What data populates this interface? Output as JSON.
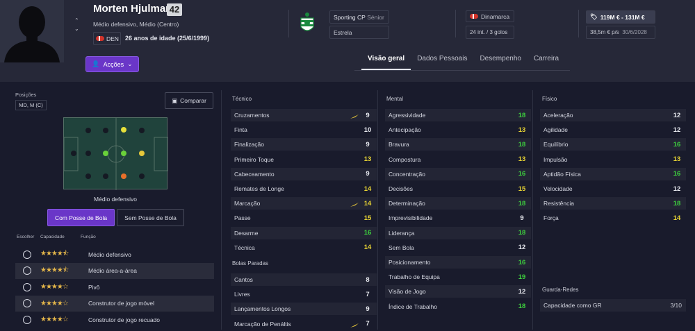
{
  "player": {
    "name": "Morten Hjulmand",
    "number": "42",
    "position": "Médio defensivo, Médio (Centro)",
    "nationality_code": "DEN",
    "age_line": "26 anos de idade (25/6/1999)"
  },
  "actions_label": "Acções",
  "club": {
    "name": "Sporting CP",
    "squad": "Sénior",
    "status": "Estrela"
  },
  "nation": {
    "name": "Dinamarca",
    "caps": "24 int. / 3 golos"
  },
  "value": {
    "range": "119M € - 131M €",
    "wage": "38,5m € p/s",
    "contract_end": "30/6/2028"
  },
  "tabs": [
    "Visão geral",
    "Dados Pessoais",
    "Desempenho",
    "Carreira"
  ],
  "left": {
    "positions_label": "Posições",
    "positions_value": "MD, M (C)",
    "compare_label": "Comparar",
    "pitch_caption": "Médio defensivo",
    "with_ball": "Com Posse de Bola",
    "without_ball": "Sem Posse de Bola",
    "col_choose": "Escolher",
    "col_ability": "Capacidade",
    "col_role": "Função"
  },
  "roles": [
    {
      "name": "Médio defensivo",
      "stars": 4.5
    },
    {
      "name": "Médio área-a-área",
      "stars": 4.5
    },
    {
      "name": "Pivô",
      "stars": 4
    },
    {
      "name": "Construtor de jogo móvel",
      "stars": 4
    },
    {
      "name": "Construtor de jogo recuado",
      "stars": 4
    }
  ],
  "technical": {
    "title": "Técnico",
    "attrs": [
      {
        "n": "Cruzamentos",
        "v": "9"
      },
      {
        "n": "Finta",
        "v": "10"
      },
      {
        "n": "Finalização",
        "v": "9"
      },
      {
        "n": "Primeiro Toque",
        "v": "13"
      },
      {
        "n": "Cabeceamento",
        "v": "9"
      },
      {
        "n": "Remates de Longe",
        "v": "14"
      },
      {
        "n": "Marcação",
        "v": "14"
      },
      {
        "n": "Passe",
        "v": "15"
      },
      {
        "n": "Desarme",
        "v": "16"
      },
      {
        "n": "Técnica",
        "v": "14"
      }
    ]
  },
  "set_pieces": {
    "title": "Bolas Paradas",
    "attrs": [
      {
        "n": "Cantos",
        "v": "8"
      },
      {
        "n": "Livres",
        "v": "7"
      },
      {
        "n": "Lançamentos Longos",
        "v": "9"
      },
      {
        "n": "Marcação de Penáltis",
        "v": "7"
      }
    ]
  },
  "mental": {
    "title": "Mental",
    "attrs": [
      {
        "n": "Agressividade",
        "v": "18"
      },
      {
        "n": "Antecipação",
        "v": "13"
      },
      {
        "n": "Bravura",
        "v": "18"
      },
      {
        "n": "Compostura",
        "v": "13"
      },
      {
        "n": "Concentração",
        "v": "16"
      },
      {
        "n": "Decisões",
        "v": "15"
      },
      {
        "n": "Determinação",
        "v": "18"
      },
      {
        "n": "Imprevisibilidade",
        "v": "9"
      },
      {
        "n": "Liderança",
        "v": "18"
      },
      {
        "n": "Sem Bola",
        "v": "12"
      },
      {
        "n": "Posicionamento",
        "v": "16"
      },
      {
        "n": "Trabalho de Equipa",
        "v": "19"
      },
      {
        "n": "Visão de Jogo",
        "v": "12"
      },
      {
        "n": "Índice de Trabalho",
        "v": "18"
      }
    ]
  },
  "physical": {
    "title": "Físico",
    "attrs": [
      {
        "n": "Aceleração",
        "v": "12"
      },
      {
        "n": "Agilidade",
        "v": "12"
      },
      {
        "n": "Equilíbrio",
        "v": "16"
      },
      {
        "n": "Impulsão",
        "v": "13"
      },
      {
        "n": "Aptidão Física",
        "v": "16"
      },
      {
        "n": "Velocidade",
        "v": "12"
      },
      {
        "n": "Resistência",
        "v": "18"
      },
      {
        "n": "Força",
        "v": "14"
      }
    ]
  },
  "goalkeeping": {
    "title": "Guarda-Redes",
    "label": "Capacidade como GR",
    "value": "3/10"
  }
}
